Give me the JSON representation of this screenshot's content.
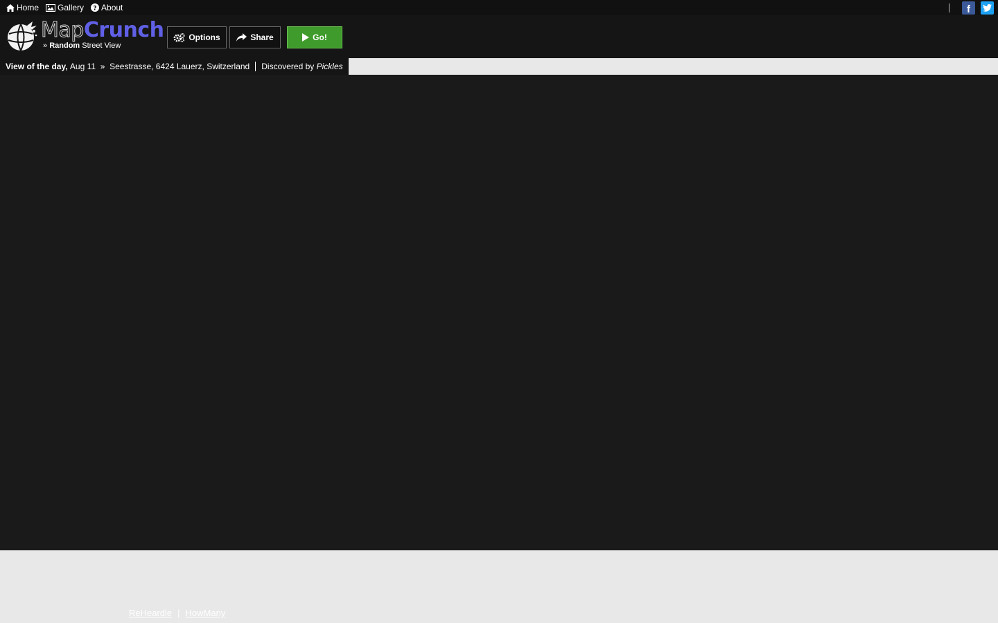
{
  "nav": {
    "home": "Home",
    "gallery": "Gallery",
    "about": "About"
  },
  "social": {
    "facebook_glyph": "f",
    "twitter_glyph": "t"
  },
  "brand": {
    "name_part1": "Map",
    "name_part2": "Crunch",
    "tagline_prefix": "»",
    "tagline_bold": "Random",
    "tagline_rest": "Street View"
  },
  "toolbar": {
    "options": "Options",
    "share": "Share",
    "go": "Go!"
  },
  "view_of_day": {
    "label": "View of the day,",
    "date": "Aug 11",
    "arrow": "»",
    "location": "Seestrasse, 6424 Lauerz, Switzerland",
    "discovered_prefix": "Discovered by",
    "discoverer": "Pickles"
  },
  "footer": {
    "link1": "ReHeardle",
    "separator": "|",
    "link2": "HowMany"
  },
  "colors": {
    "brand_accent": "#6060e6",
    "go_button": "#3f9b2b",
    "header_bg": "#151515",
    "map_bg": "#1a1a1a"
  }
}
